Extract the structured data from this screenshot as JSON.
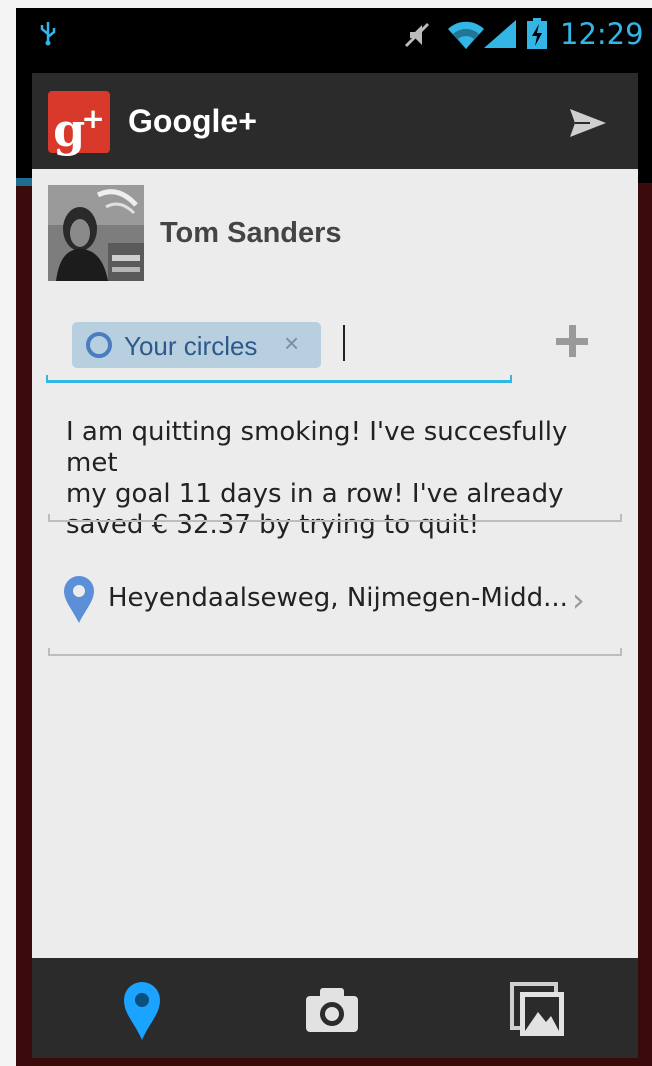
{
  "status_bar": {
    "time": "12:29",
    "icons": [
      "usb-icon",
      "mute-icon",
      "wifi-icon",
      "signal-icon",
      "battery-charging-icon"
    ],
    "accent_color": "#33b5e5"
  },
  "action_bar": {
    "title": "Google+",
    "logo_icon": "google-plus-icon",
    "send_icon": "send-icon"
  },
  "author": {
    "name": "Tom Sanders",
    "avatar_icon": "avatar"
  },
  "recipients": {
    "chips": [
      {
        "label": "Your circles",
        "icon": "circle-icon",
        "remove_glyph": "×"
      }
    ],
    "add_icon": "plus-icon"
  },
  "post": {
    "text": "I am quitting smoking! I've succesfully met\nmy goal 11 days in a row! I've already\nsaved € 32.37 by trying to quit!"
  },
  "location": {
    "text": "Heyendaalseweg, Nijmegen-Midd...",
    "chevron": "›"
  },
  "bottom_bar": {
    "buttons": [
      "location-pin-icon",
      "camera-icon",
      "gallery-icon"
    ],
    "active_color": "#1aa3ff"
  }
}
